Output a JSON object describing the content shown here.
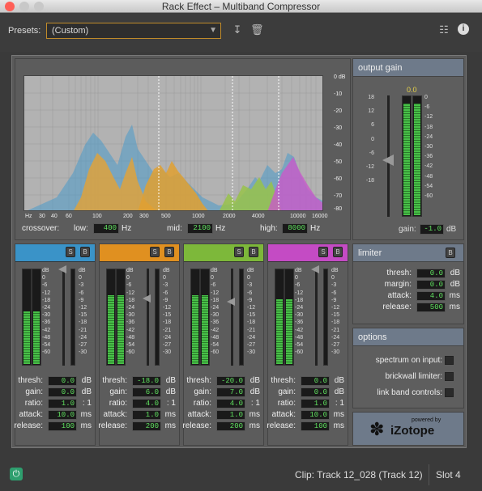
{
  "window": {
    "title": "Rack Effect – Multiband Compressor"
  },
  "toolbar": {
    "presets_label": "Presets:",
    "preset_value": "(Custom)",
    "save_icon": "save-preset-icon",
    "delete_icon": "trash-icon",
    "routing_icon": "routing-icon",
    "info_icon": "info-icon"
  },
  "spectrum": {
    "db_ticks": [
      "0 dB",
      "-10",
      "-20",
      "-30",
      "-40",
      "-50",
      "-60",
      "-70",
      "-80"
    ],
    "freq_ticks": [
      "Hz",
      "30",
      "40",
      "60",
      "100",
      "200",
      "300",
      "500",
      "1000",
      "2000",
      "4000",
      "10000",
      "16000"
    ],
    "crossover_label": "crossover:",
    "low_label": "low:",
    "low_value": "400",
    "low_unit": "Hz",
    "mid_label": "mid:",
    "mid_value": "2100",
    "mid_unit": "Hz",
    "high_label": "high:",
    "high_value": "8000",
    "high_unit": "Hz"
  },
  "output_gain": {
    "title": "output gain",
    "peak": "0.0",
    "left_scale": [
      "18",
      "12",
      "6",
      "0",
      "-6",
      "-12",
      "-18"
    ],
    "right_scale": [
      "0",
      "-6",
      "-12",
      "-18",
      "-24",
      "-30",
      "-36",
      "-42",
      "-48",
      "-54",
      "-60"
    ],
    "gain_label": "gain:",
    "gain_value": "-1.0",
    "gain_unit": "dB",
    "meter_level": 0.93
  },
  "band_scale_left": [
    "0",
    "-6",
    "-12",
    "-18",
    "-24",
    "-30",
    "-36",
    "-42",
    "-48",
    "-54",
    "-60"
  ],
  "band_scale_right": [
    "0",
    "-3",
    "-6",
    "-9",
    "-12",
    "-15",
    "-18",
    "-21",
    "-24",
    "-27",
    "-30"
  ],
  "band_scale_left_top": "dB",
  "band_scale_right_top": "dB",
  "bands": [
    {
      "color": "#3a93c8",
      "thresh": "0.0",
      "gain": "0.0",
      "ratio": "1.0",
      "attack": "10.0",
      "release": "100",
      "meter": 0.55,
      "thumb": 0.0
    },
    {
      "color": "#e09020",
      "thresh": "-18.0",
      "gain": "6.0",
      "ratio": "4.0",
      "attack": "1.0",
      "release": "200",
      "meter": 0.72,
      "thumb": 0.3
    },
    {
      "color": "#7db83a",
      "thresh": "-20.0",
      "gain": "7.0",
      "ratio": "4.0",
      "attack": "1.0",
      "release": "200",
      "meter": 0.72,
      "thumb": 0.33
    },
    {
      "color": "#c44bc4",
      "thresh": "0.0",
      "gain": "0.0",
      "ratio": "1.0",
      "attack": "10.0",
      "release": "100",
      "meter": 0.68,
      "thumb": 0.0
    }
  ],
  "band_labels": {
    "s": "S",
    "b": "B",
    "thresh": "thresh:",
    "gain": "gain:",
    "ratio": "ratio:",
    "attack": "attack:",
    "release": "release:",
    "db": "dB",
    "ratio_unit": ": 1",
    "ms": "ms"
  },
  "limiter": {
    "title": "limiter",
    "bypass": "B",
    "thresh_label": "thresh:",
    "thresh_value": "0.0",
    "thresh_unit": "dB",
    "margin_label": "margin:",
    "margin_value": "0.0",
    "margin_unit": "dB",
    "attack_label": "attack:",
    "attack_value": "4.0",
    "attack_unit": "ms",
    "release_label": "release:",
    "release_value": "500",
    "release_unit": "ms"
  },
  "options": {
    "title": "options",
    "spectrum_label": "spectrum on input:",
    "brickwall_label": "brickwall limiter:",
    "link_label": "link band controls:"
  },
  "logo": {
    "powered": "powered by",
    "brand": "iZotope"
  },
  "footer": {
    "clip": "Clip: Track 12_028 (Track 12)",
    "slot": "Slot 4",
    "power_icon": "power-icon"
  }
}
